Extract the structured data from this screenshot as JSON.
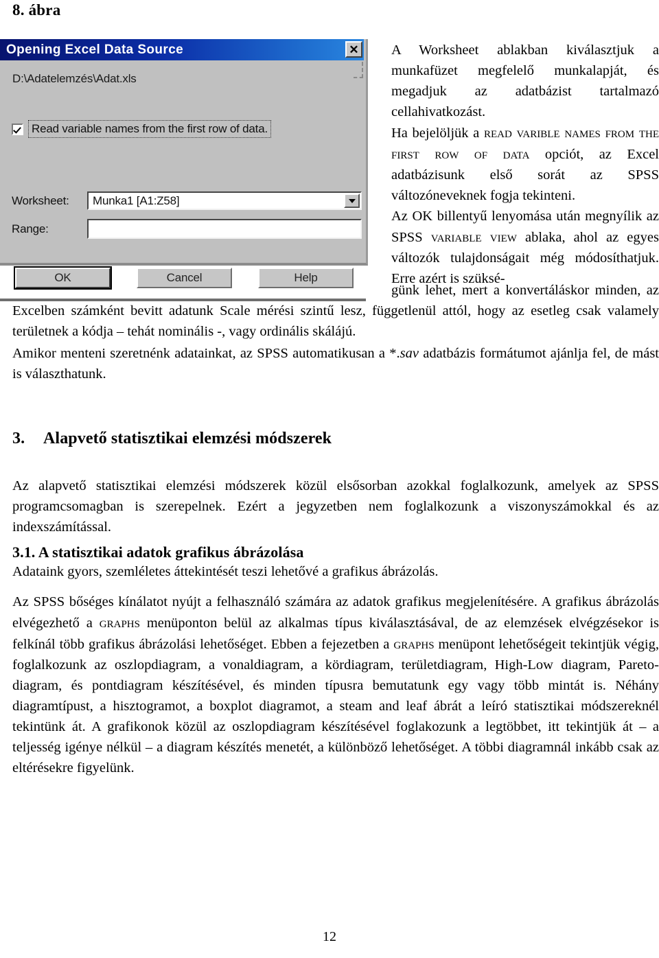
{
  "figure": {
    "caption": "8. ábra"
  },
  "dialog": {
    "title": "Opening Excel Data Source",
    "close_label": "✕",
    "file_path": "D:\\Adatelemzés\\Adat.xls",
    "checkbox": {
      "label": "Read variable names from the first row of data.",
      "checked": true
    },
    "worksheet": {
      "label": "Worksheet:",
      "value": "Munka1  [A1:Z58]"
    },
    "range": {
      "label": "Range:",
      "value": ""
    },
    "buttons": {
      "ok": "OK",
      "cancel": "Cancel",
      "help": "Help"
    },
    "colors": {
      "titlebar_dark": "#07136e",
      "titlebar_light": "#2a86e0",
      "face": "#c0c0c0",
      "field": "#ffffff"
    }
  },
  "body": {
    "right_column": {
      "p1": "A Worksheet ablakban kiválasztjuk a munkafüzet megfelelő munkalapját, és megadjuk az adatbázist tartalmazó cellahivatkozást.",
      "p2_lead": "Ha bejelöljük a ",
      "p2_sc": "Read varible names from the first row of data",
      "p2_tail": " opciót, az Excel adatbázisunk első sorát az SPSS változóneveknek fogja tekinteni.",
      "p3_lead": "Az OK billentyű lenyomása után megnyílik az SPSS ",
      "p3_sc": "Variable View",
      "p3_tail": " ablaka, ahol az egyes változók tulajdonságait még módosíthatjuk. Erre azért is szüksé-"
    },
    "wrap_paragraph": "günk lehet, mert a konvertáláskor minden, az Excelben számként bevitt adatunk Scale mérési szintű lesz, függetlenül attól, hogy az esetleg csak valamely területnek a kódja – tehát nominális -, vagy ordinális skálájú.",
    "save_paragraph_lead": "Amikor menteni szeretnénk adatainkat, az SPSS automatikusan a *.",
    "save_paragraph_ital": "sav",
    "save_paragraph_tail": " adatbázis formátumot ajánlja fel, de mást is választhatunk."
  },
  "headings": {
    "h1_number": "3.",
    "h1_text": "Alapvető statisztikai elemzési módszerek",
    "h2_text": "3.1. A statisztikai adatok grafikus ábrázolása"
  },
  "sections": {
    "intro_paragraph": "Az alapvető statisztikai elemzési módszerek közül elsősorban azokkal foglalkozunk, amelyek az SPSS programcsomagban is szerepelnek. Ezért a jegyzetben nem foglalkozunk a viszonyszámokkal és az indexszámítással.",
    "p311": "Adataink gyors, szemléletes áttekintését teszi lehetővé a grafikus ábrázolás.",
    "graphics_seg1": "Az SPSS bőséges kínálatot nyújt a felhasználó számára az adatok grafikus megjelenítésére. A grafikus ábrázolás elvégezhető a ",
    "graphics_sc1": "Graphs",
    "graphics_seg2": " menüponton belül az alkalmas típus kiválasztásával, de az elemzések elvégzésekor is felkínál több grafikus ábrázolási lehetőséget. Ebben a fejezetben a ",
    "graphics_sc2": "Graphs",
    "graphics_seg3": " menüpont lehetőségeit tekintjük végig, foglalkozunk az oszlopdiagram, a vonaldiagram, a kördiagram, területdiagram, High-Low diagram, Pareto-diagram, és pontdiagram készítésével, és minden típusra bemutatunk egy vagy több mintát is. Néhány diagramtípust, a hisztogramot, a boxplot diagramot, a steam and leaf ábrát a leíró statisztikai módszereknél tekintünk át. A grafikonok közül az oszlopdiagram készítésével foglakozunk a legtöbbet, itt tekintjük át – a teljesség igénye nélkül – a diagram készítés menetét, a különböző lehetőséget. A többi diagramnál inkább csak az eltérésekre figyelünk."
  },
  "footer": {
    "page_number": "12"
  }
}
